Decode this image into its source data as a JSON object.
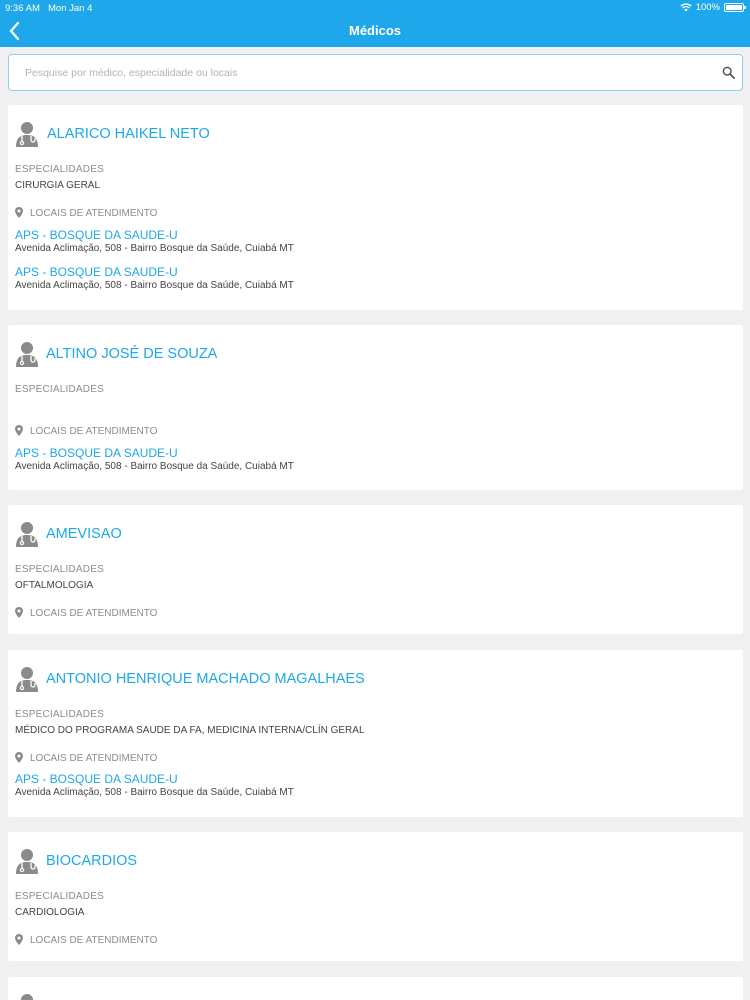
{
  "status_bar": {
    "time": "9:36 AM",
    "date": "Mon Jan 4",
    "battery": "100%"
  },
  "header": {
    "title": "Médicos",
    "back_icon": "chevron-left-icon"
  },
  "search": {
    "placeholder": "Pesquise por médico, especialidade ou locais",
    "icon": "search-icon"
  },
  "labels": {
    "specialties": "ESPECIALIDADES",
    "locations": "LOCAIS DE ATENDIMENTO"
  },
  "doctors": [
    {
      "name": "ALARICO HAIKEL NETO",
      "specialty": "CIRURGIA GERAL",
      "locations": [
        {
          "name": "APS - BOSQUE DA SAUDE-U",
          "address": "Avenida Aclimação, 508 - Bairro Bosque da Saúde, Cuiabá MT"
        },
        {
          "name": "APS - BOSQUE DA SAUDE-U",
          "address": "Avenida Aclimação, 508 - Bairro Bosque da Saúde, Cuiabá MT"
        }
      ]
    },
    {
      "name": "ALTINO JOSÉ DE SOUZA",
      "specialty": "",
      "locations": [
        {
          "name": "APS - BOSQUE DA SAUDE-U",
          "address": "Avenida Aclimação, 508 - Bairro Bosque da Saúde, Cuiabá MT"
        }
      ]
    },
    {
      "name": "AMEVISAO",
      "specialty": "OFTALMOLOGIA",
      "locations": []
    },
    {
      "name": "ANTONIO HENRIQUE MACHADO MAGALHAES",
      "specialty": "MÉDICO DO PROGRAMA SAUDE DA FA, MEDICINA INTERNA/CLÍN GERAL",
      "locations": [
        {
          "name": "APS - BOSQUE DA SAUDE-U",
          "address": "Avenida Aclimação, 508 - Bairro Bosque da Saúde, Cuiabá MT"
        }
      ]
    },
    {
      "name": "BIOCARDIOS",
      "specialty": "CARDIOLOGIA",
      "locations": []
    }
  ],
  "colors": {
    "accent": "#1ea7ea",
    "background": "#f0f0f0",
    "card": "#ffffff"
  }
}
